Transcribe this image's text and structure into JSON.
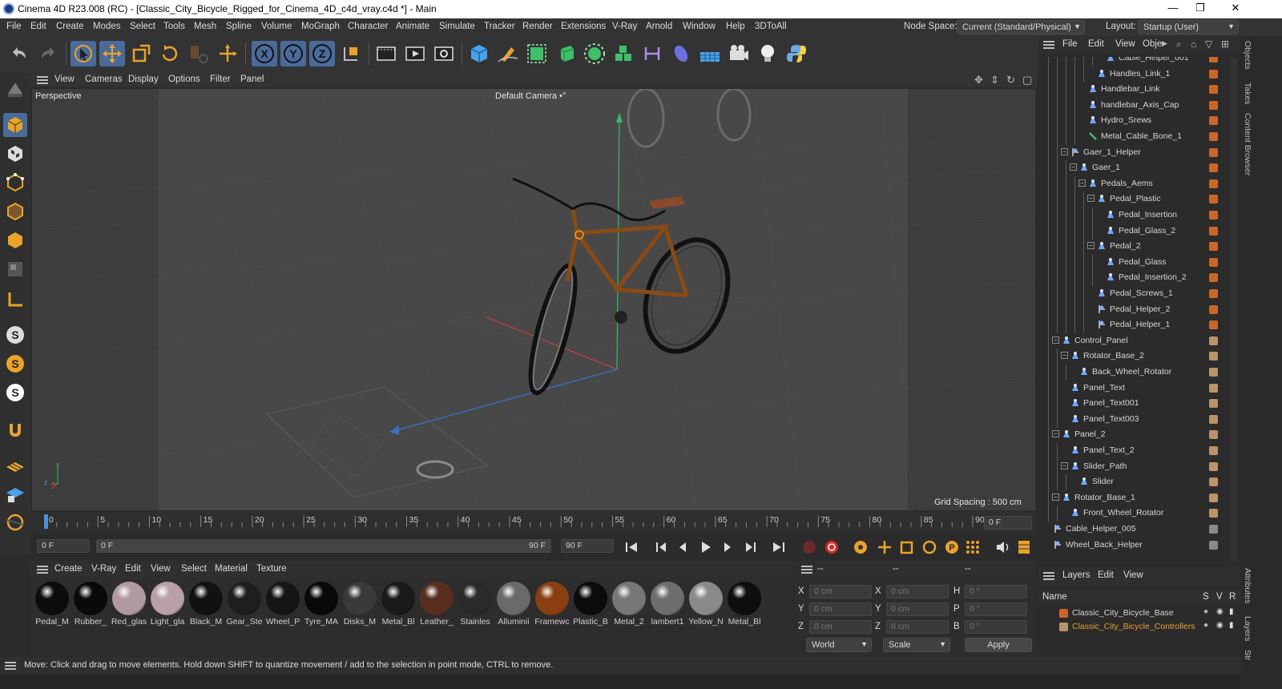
{
  "window": {
    "title": "Cinema 4D R23.008 (RC) - [Classic_City_Bicycle_Rigged_for_Cinema_4D_c4d_vray.c4d *] - Main",
    "minimize": "—",
    "maximize": "❐",
    "close": "✕"
  },
  "menubar": {
    "items": [
      "File",
      "Edit",
      "Create",
      "Modes",
      "Select",
      "Tools",
      "Mesh",
      "Spline",
      "Volume",
      "MoGraph",
      "Character",
      "Animate",
      "Simulate",
      "Tracker",
      "Render",
      "Extensions",
      "V-Ray",
      "Arnold",
      "Window",
      "Help",
      "3DToAll"
    ],
    "node_space_label": "Node Space:",
    "node_space_value": "Current (Standard/Physical)",
    "layout_label": "Layout:",
    "layout_value": "Startup (User)"
  },
  "toolbar": {
    "icons": [
      "undo-icon",
      "redo-icon",
      "live-select-icon",
      "move-icon",
      "scale-icon",
      "rotate-icon",
      "recent-tools-icon",
      "axis-move-icon",
      "x-axis-icon",
      "y-axis-icon",
      "z-axis-icon",
      "coordinate-system-icon",
      "render-region-icon",
      "render-view-icon",
      "render-settings-icon",
      "cube-icon",
      "pen-icon",
      "subdivision-icon",
      "extrude-icon",
      "cloner-icon",
      "mograph-icon",
      "deformer-icon",
      "field-icon",
      "floor-icon",
      "camera-icon",
      "light-icon",
      "python-icon"
    ]
  },
  "viewport": {
    "menu": [
      "View",
      "Cameras",
      "Display",
      "Options",
      "Filter",
      "Panel"
    ],
    "view_name": "Perspective",
    "camera_name": "Default Camera",
    "camera_mark": "•°",
    "grid_spacing": "Grid Spacing : 500 cm",
    "axis_y": "y",
    "axis_z": "z",
    "axis_x": "x"
  },
  "timeline": {
    "ticks": [
      "0",
      "5",
      "10",
      "15",
      "20",
      "25",
      "30",
      "35",
      "40",
      "45",
      "50",
      "55",
      "60",
      "65",
      "70",
      "75",
      "80",
      "85",
      "90"
    ],
    "current_frame_field": "0 F"
  },
  "playbar": {
    "start_field": "0 F",
    "range_start": "0 F",
    "range_end": "90 F",
    "end_field": "90 F"
  },
  "materials": {
    "menu": [
      "Create",
      "V-Ray",
      "Edit",
      "View",
      "Select",
      "Material",
      "Texture"
    ],
    "items": [
      {
        "label": "Pedal_M",
        "color": "#0c0c0c"
      },
      {
        "label": "Rubber_",
        "color": "#0a0a0a"
      },
      {
        "label": "Red_glas",
        "color": "#b09aa0"
      },
      {
        "label": "Light_gla",
        "color": "#b8a0a6"
      },
      {
        "label": "Black_M",
        "color": "#111111"
      },
      {
        "label": "Gear_Ste",
        "color": "#1e1e1e"
      },
      {
        "label": "Wheel_P",
        "color": "#151515"
      },
      {
        "label": "Tyre_MA",
        "color": "#090909"
      },
      {
        "label": "Disks_M",
        "color": "#3a3a3a"
      },
      {
        "label": "Metal_Bl",
        "color": "#1a1a1a"
      },
      {
        "label": "Leather_",
        "color": "#5a2e1e"
      },
      {
        "label": "Stainles",
        "color": "#2a2a2a"
      },
      {
        "label": "Alluminii",
        "color": "#6a6a6a"
      },
      {
        "label": "Framewc",
        "color": "#8a3f12"
      },
      {
        "label": "Plastic_B",
        "color": "#0b0b0b"
      },
      {
        "label": "Metal_2",
        "color": "#777777"
      },
      {
        "label": "lambert1",
        "color": "#6e6e6e"
      },
      {
        "label": "Yellow_N",
        "color": "#8a8a8a"
      },
      {
        "label": "Metal_Bl",
        "color": "#0e0e0e"
      }
    ]
  },
  "coordinates": {
    "col1": "--",
    "col2": "--",
    "col3": "--",
    "rows": [
      {
        "a": "X",
        "av": "0 cm",
        "b": "X",
        "bv": "0 cm",
        "c": "H",
        "cv": "0 °"
      },
      {
        "a": "Y",
        "av": "0 cm",
        "b": "Y",
        "bv": "0 cm",
        "c": "P",
        "cv": "0 °"
      },
      {
        "a": "Z",
        "av": "0 cm",
        "b": "Z",
        "bv": "0 cm",
        "c": "B",
        "cv": "0 °"
      }
    ],
    "space": "World",
    "mode": "Scale",
    "apply": "Apply"
  },
  "objects": {
    "menu": [
      "File",
      "Edit",
      "View",
      "Obje"
    ],
    "rows": [
      {
        "name": "Cable_Helper_001",
        "indent": 6,
        "type": "joint",
        "color": "#c9672a"
      },
      {
        "name": "Handles_Link_1",
        "indent": 5,
        "type": "joint",
        "color": "#c9672a"
      },
      {
        "name": "Handlebar_Link",
        "indent": 4,
        "type": "joint",
        "color": "#c9672a"
      },
      {
        "name": "handlebar_Axis_Cap",
        "indent": 4,
        "type": "joint",
        "color": "#c9672a"
      },
      {
        "name": "Hydro_Srews",
        "indent": 4,
        "type": "joint",
        "color": "#c9672a"
      },
      {
        "name": "Metal_Cable_Bone_1",
        "indent": 4,
        "type": "bone",
        "color": "#c9672a"
      },
      {
        "name": "Gaer_1_Helper",
        "indent": 2,
        "type": "null",
        "color": "#c9672a"
      },
      {
        "name": "Gaer_1",
        "indent": 3,
        "type": "joint",
        "color": "#c9672a"
      },
      {
        "name": "Pedals_Aems",
        "indent": 4,
        "type": "joint",
        "color": "#c9672a"
      },
      {
        "name": "Pedal_Plastic",
        "indent": 5,
        "type": "joint",
        "color": "#c9672a"
      },
      {
        "name": "Pedal_Insertion",
        "indent": 6,
        "type": "joint",
        "color": "#c9672a"
      },
      {
        "name": "Pedal_Glass_2",
        "indent": 6,
        "type": "joint",
        "color": "#c9672a"
      },
      {
        "name": "Pedal_2",
        "indent": 5,
        "type": "joint",
        "color": "#c9672a"
      },
      {
        "name": "Pedal_Glass",
        "indent": 6,
        "type": "joint",
        "color": "#c9672a"
      },
      {
        "name": "Pedal_Insertion_2",
        "indent": 6,
        "type": "joint",
        "color": "#c9672a"
      },
      {
        "name": "Pedal_Screws_1",
        "indent": 5,
        "type": "joint",
        "color": "#c9672a"
      },
      {
        "name": "Pedal_Helper_2",
        "indent": 5,
        "type": "null",
        "color": "#c9672a"
      },
      {
        "name": "Pedal_Helper_1",
        "indent": 5,
        "type": "null",
        "color": "#c9672a"
      },
      {
        "name": "Control_Panel",
        "indent": 1,
        "type": "joint",
        "color": "#b8946a"
      },
      {
        "name": "Rotator_Base_2",
        "indent": 2,
        "type": "joint",
        "color": "#b8946a"
      },
      {
        "name": "Back_Wheel_Rotator",
        "indent": 3,
        "type": "joint",
        "color": "#b8946a"
      },
      {
        "name": "Panel_Text",
        "indent": 2,
        "type": "joint",
        "color": "#b8946a"
      },
      {
        "name": "Panel_Text001",
        "indent": 2,
        "type": "joint",
        "color": "#b8946a"
      },
      {
        "name": "Panel_Text003",
        "indent": 2,
        "type": "joint",
        "color": "#b8946a"
      },
      {
        "name": "Panel_2",
        "indent": 1,
        "type": "joint",
        "color": "#b8946a"
      },
      {
        "name": "Panel_Text_2",
        "indent": 2,
        "type": "joint",
        "color": "#b8946a"
      },
      {
        "name": "Slider_Path",
        "indent": 2,
        "type": "joint",
        "color": "#b8946a"
      },
      {
        "name": "Slider",
        "indent": 3,
        "type": "joint",
        "color": "#b8946a"
      },
      {
        "name": "Rotator_Base_1",
        "indent": 1,
        "type": "joint",
        "color": "#b8946a"
      },
      {
        "name": "Front_Wheel_Rotator",
        "indent": 2,
        "type": "joint",
        "color": "#b8946a"
      },
      {
        "name": "Cable_Helper_005",
        "indent": 0,
        "type": "null",
        "color": "#8a8a8a"
      },
      {
        "name": "Wheel_Back_Helper",
        "indent": 0,
        "type": "null",
        "color": "#8a8a8a"
      }
    ]
  },
  "layers": {
    "menu": [
      "Layers",
      "Edit",
      "View"
    ],
    "columns": [
      "Name",
      "S",
      "V",
      "R"
    ],
    "rows": [
      {
        "name": "Classic_City_Bicycle_Base",
        "color": "#c9672a",
        "text_color": "#d6d6d6"
      },
      {
        "name": "Classic_City_Bicycle_Controllers",
        "color": "#b8946a",
        "text_color": "#e7a034"
      }
    ]
  },
  "side_tabs": [
    "Objects",
    "Takes",
    "Content Browser",
    "Attributes",
    "Layers",
    "Str"
  ],
  "status": {
    "text": "Move: Click and drag to move elements. Hold down SHIFT to quantize movement / add to the selection in point mode, CTRL to remove."
  }
}
